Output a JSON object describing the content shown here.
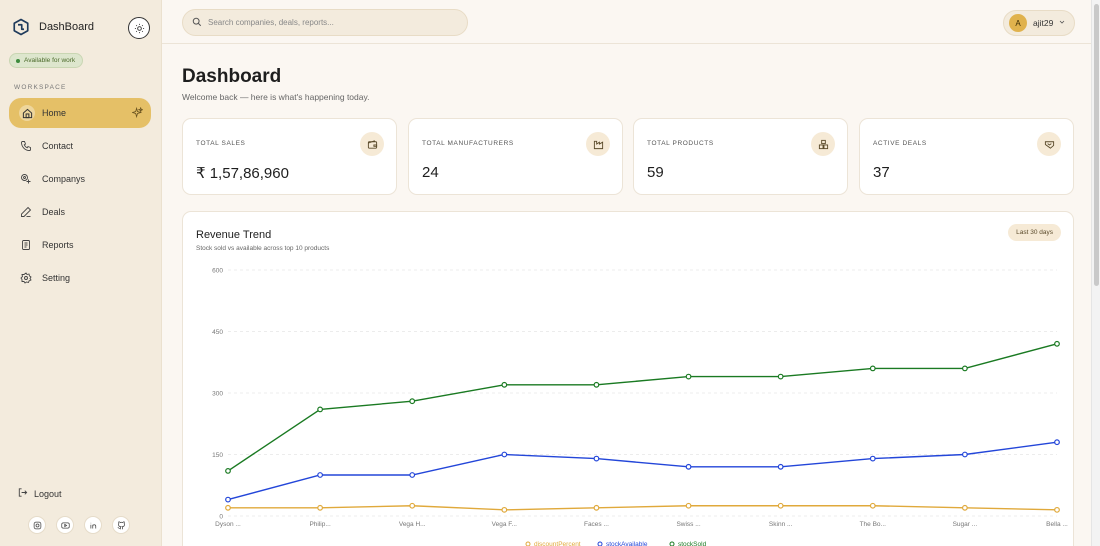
{
  "brand": {
    "name": "DashBoard"
  },
  "availability": "Available for work",
  "sidebar": {
    "section_label": "WORKSPACE",
    "items": [
      {
        "label": "Home",
        "icon": "home-icon",
        "active": true
      },
      {
        "label": "Contact",
        "icon": "phone-icon"
      },
      {
        "label": "Companys",
        "icon": "companies-icon"
      },
      {
        "label": "Deals",
        "icon": "pencil-icon"
      },
      {
        "label": "Reports",
        "icon": "report-icon"
      },
      {
        "label": "Setting",
        "icon": "gear-icon"
      }
    ],
    "logout_label": "Logout"
  },
  "search": {
    "placeholder": "Search companies, deals, reports..."
  },
  "user": {
    "initial": "A",
    "name": "ajit29"
  },
  "header": {
    "title": "Dashboard",
    "subtitle": "Welcome back — here is what's happening today."
  },
  "stats": [
    {
      "label": "TOTAL SALES",
      "value": "₹ 1,57,86,960",
      "icon": "wallet-icon"
    },
    {
      "label": "TOTAL MANUFACTURERS",
      "value": "24",
      "icon": "factory-icon"
    },
    {
      "label": "TOTAL PRODUCTS",
      "value": "59",
      "icon": "boxes-icon"
    },
    {
      "label": "ACTIVE DEALS",
      "value": "37",
      "icon": "handshake-icon"
    }
  ],
  "chart": {
    "title": "Revenue Trend",
    "subtitle": "Stock sold vs available across top 10 products",
    "range_label": "Last 30 days"
  },
  "chart_data": {
    "type": "line",
    "categories": [
      "Dyson ...",
      "Philip...",
      "Vega H...",
      "Vega F...",
      "Faces ...",
      "Swiss ...",
      "Skinn ...",
      "The Bo...",
      "Sugar ...",
      "Bella ..."
    ],
    "ylim": [
      0,
      600
    ],
    "yticks": [
      0,
      150,
      300,
      450,
      600
    ],
    "grid": true,
    "legend_position": "bottom",
    "series": [
      {
        "name": "discountPercent",
        "color": "#e0a93b",
        "values": [
          20,
          20,
          25,
          15,
          20,
          25,
          25,
          25,
          20,
          15
        ]
      },
      {
        "name": "stockAvailable",
        "color": "#2346d9",
        "values": [
          40,
          100,
          100,
          150,
          140,
          120,
          120,
          140,
          150,
          180
        ]
      },
      {
        "name": "stockSold",
        "color": "#1a7a22",
        "values": [
          110,
          260,
          280,
          320,
          320,
          340,
          340,
          360,
          360,
          420
        ]
      }
    ]
  },
  "colors": {
    "accent": "#e5c067",
    "sidebar_bg": "#f3ebdd",
    "page_bg": "#fbf7f2"
  }
}
